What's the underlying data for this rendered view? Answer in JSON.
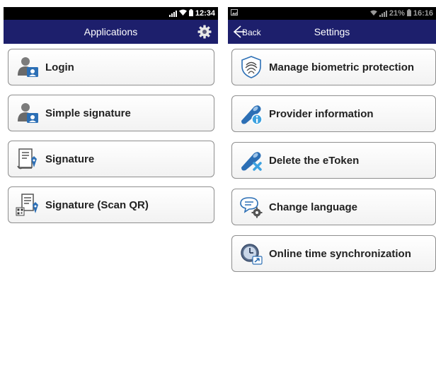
{
  "left_screen": {
    "status": {
      "time": "12:34",
      "icons": [
        "signal-icon",
        "wifi-icon",
        "battery-icon"
      ]
    },
    "appbar": {
      "title": "Applications",
      "settings_icon": "gear-icon"
    },
    "items": [
      {
        "label": "Login",
        "icon": "user-badge-icon"
      },
      {
        "label": "Simple signature",
        "icon": "user-badge-icon"
      },
      {
        "label": "Signature",
        "icon": "document-pen-icon"
      },
      {
        "label": "Signature (Scan QR)",
        "icon": "qr-document-pen-icon"
      }
    ]
  },
  "right_screen": {
    "status": {
      "time": "16:16",
      "battery": "21%",
      "icons": [
        "image-icon",
        "wifi-icon",
        "signal-icon",
        "battery-icon"
      ]
    },
    "appbar": {
      "title": "Settings",
      "back_label": "Back"
    },
    "items": [
      {
        "label": "Manage biometric protection",
        "icon": "fingerprint-icon"
      },
      {
        "label": "Provider information",
        "icon": "token-info-icon"
      },
      {
        "label": "Delete the eToken",
        "icon": "token-delete-icon"
      },
      {
        "label": "Change language",
        "icon": "language-gear-icon"
      },
      {
        "label": "Online time synchronization",
        "icon": "clock-sync-icon"
      }
    ]
  },
  "colors": {
    "appbar": "#1d1f6c",
    "statusbar": "#000000",
    "button_border": "#8e8e8e",
    "label": "#222222",
    "icon_blue": "#2c6fb5"
  }
}
